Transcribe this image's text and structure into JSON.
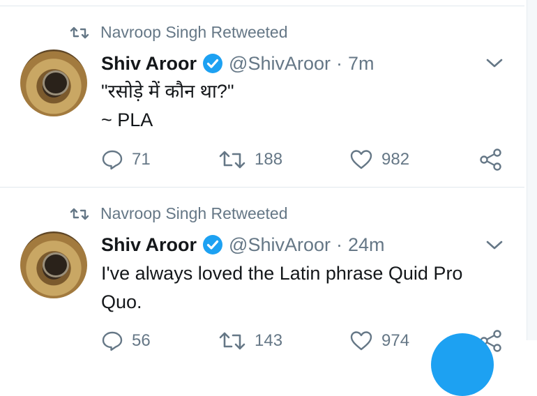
{
  "tweets": [
    {
      "retweeted_by": "Navroop Singh Retweeted",
      "name": "Shiv Aroor",
      "handle": "@ShivAroor",
      "separator": "·",
      "time": "7m",
      "text_lines": [
        "\"रसोड़े में कौन था?\"",
        "~ PLA"
      ],
      "replies": "71",
      "retweets": "188",
      "likes": "982"
    },
    {
      "retweeted_by": "Navroop Singh Retweeted",
      "name": "Shiv Aroor",
      "handle": "@ShivAroor",
      "separator": "·",
      "time": "24m",
      "text_lines": [
        "I've always loved the Latin phrase Quid Pro",
        "Quo."
      ],
      "replies": "56",
      "retweets": "143",
      "likes": "974"
    }
  ],
  "colors": {
    "text_primary": "#14171a",
    "text_secondary": "#657786",
    "verified_blue": "#1da1f2",
    "divider": "#e1e8ed"
  },
  "icons": [
    "retweet-icon",
    "verified-badge-icon",
    "chevron-down-icon",
    "reply-icon",
    "retweet-icon",
    "like-heart-icon",
    "share-icon"
  ]
}
